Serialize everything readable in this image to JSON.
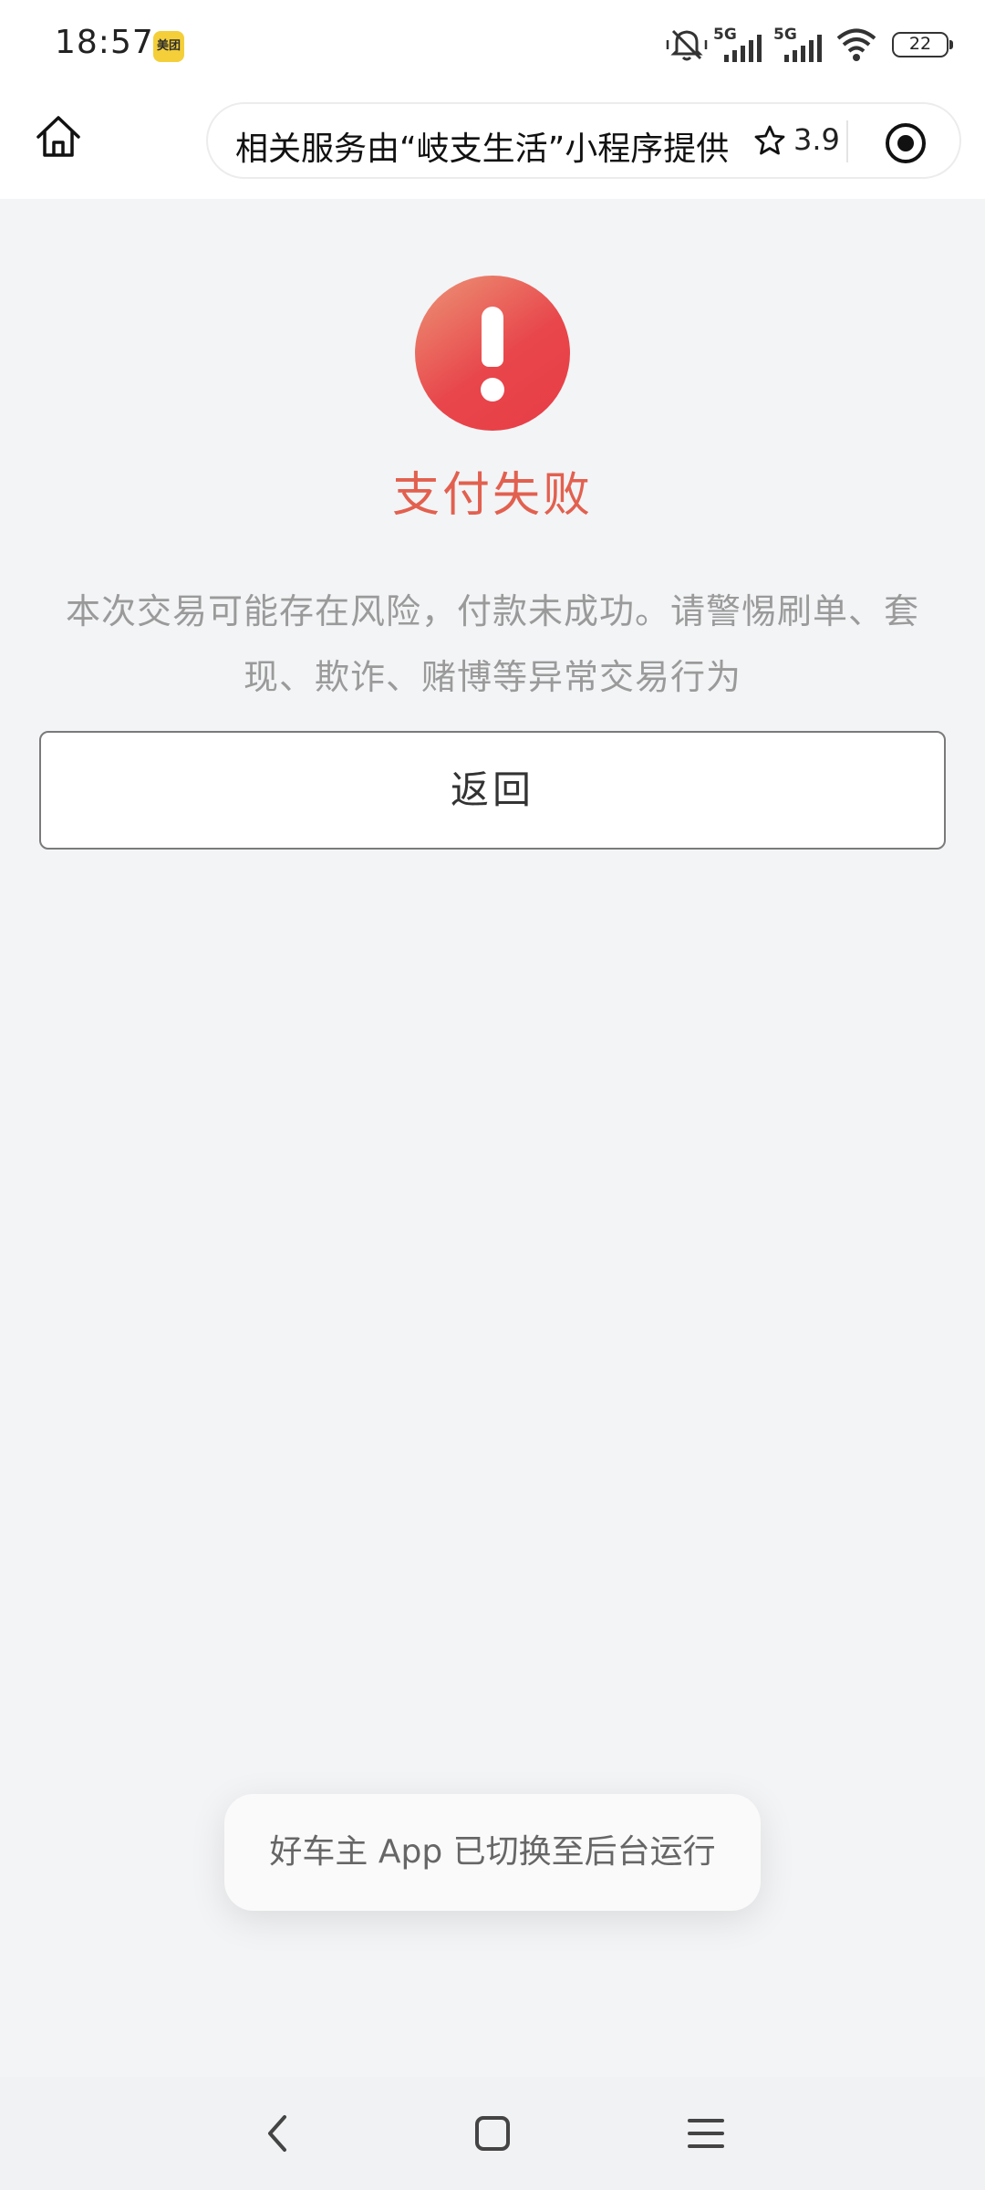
{
  "status_bar": {
    "time": "18:57",
    "app_badge": "美团",
    "battery": "22",
    "icons": [
      "mute-icon",
      "signal-5g-icon",
      "signal-5g-icon",
      "wifi-icon",
      "battery-icon"
    ]
  },
  "nav": {
    "capsule_text": "相关服务由“岐支生活”小程序提供",
    "rating": "3.9"
  },
  "result": {
    "title": "支付失败",
    "description": "本次交易可能存在风险，付款未成功。请警惕刷单、套现、欺诈、赌博等异常交易行为",
    "back_label": "返回",
    "status_color": "#e8464b"
  },
  "toast": {
    "text": "好车主 App 已切换至后台运行"
  }
}
